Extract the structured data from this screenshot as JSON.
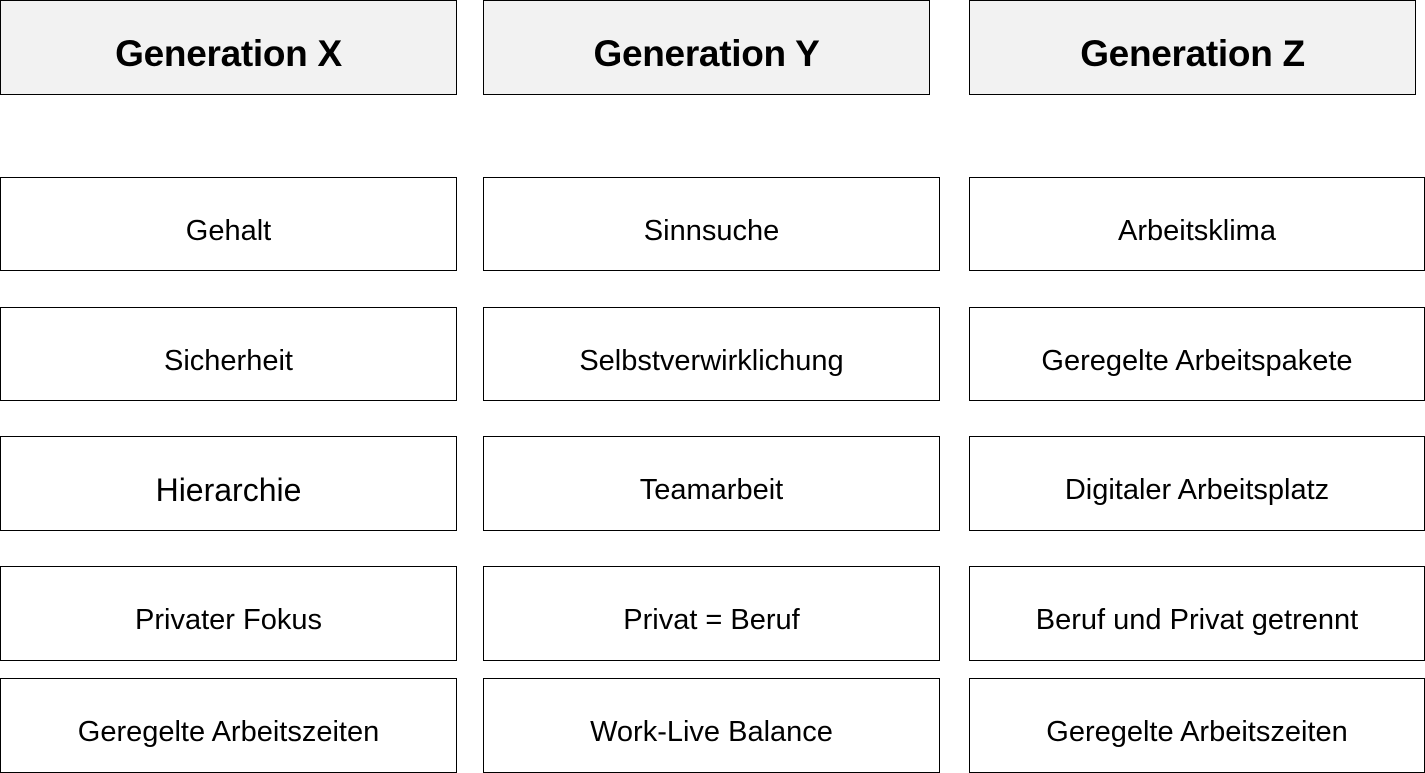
{
  "columns": [
    {
      "title": "Generation X",
      "items": [
        "Gehalt",
        "Sicherheit",
        "Hierarchie",
        "Privater Fokus",
        "Geregelte Arbeitszeiten"
      ]
    },
    {
      "title": "Generation Y",
      "items": [
        "Sinnsuche",
        "Selbstverwirklichung",
        "Teamarbeit",
        "Privat = Beruf",
        "Work-Live Balance"
      ]
    },
    {
      "title": "Generation Z",
      "items": [
        "Arbeitsklima",
        "Geregelte Arbeitspakete",
        "Digitaler Arbeitsplatz",
        "Beruf und Privat getrennt",
        "Geregelte Arbeitszeiten"
      ]
    }
  ],
  "colors": {
    "header_fill": "#f2f2f2",
    "item_fill": "#ffffff",
    "border": "#000000",
    "text": "#000000"
  }
}
